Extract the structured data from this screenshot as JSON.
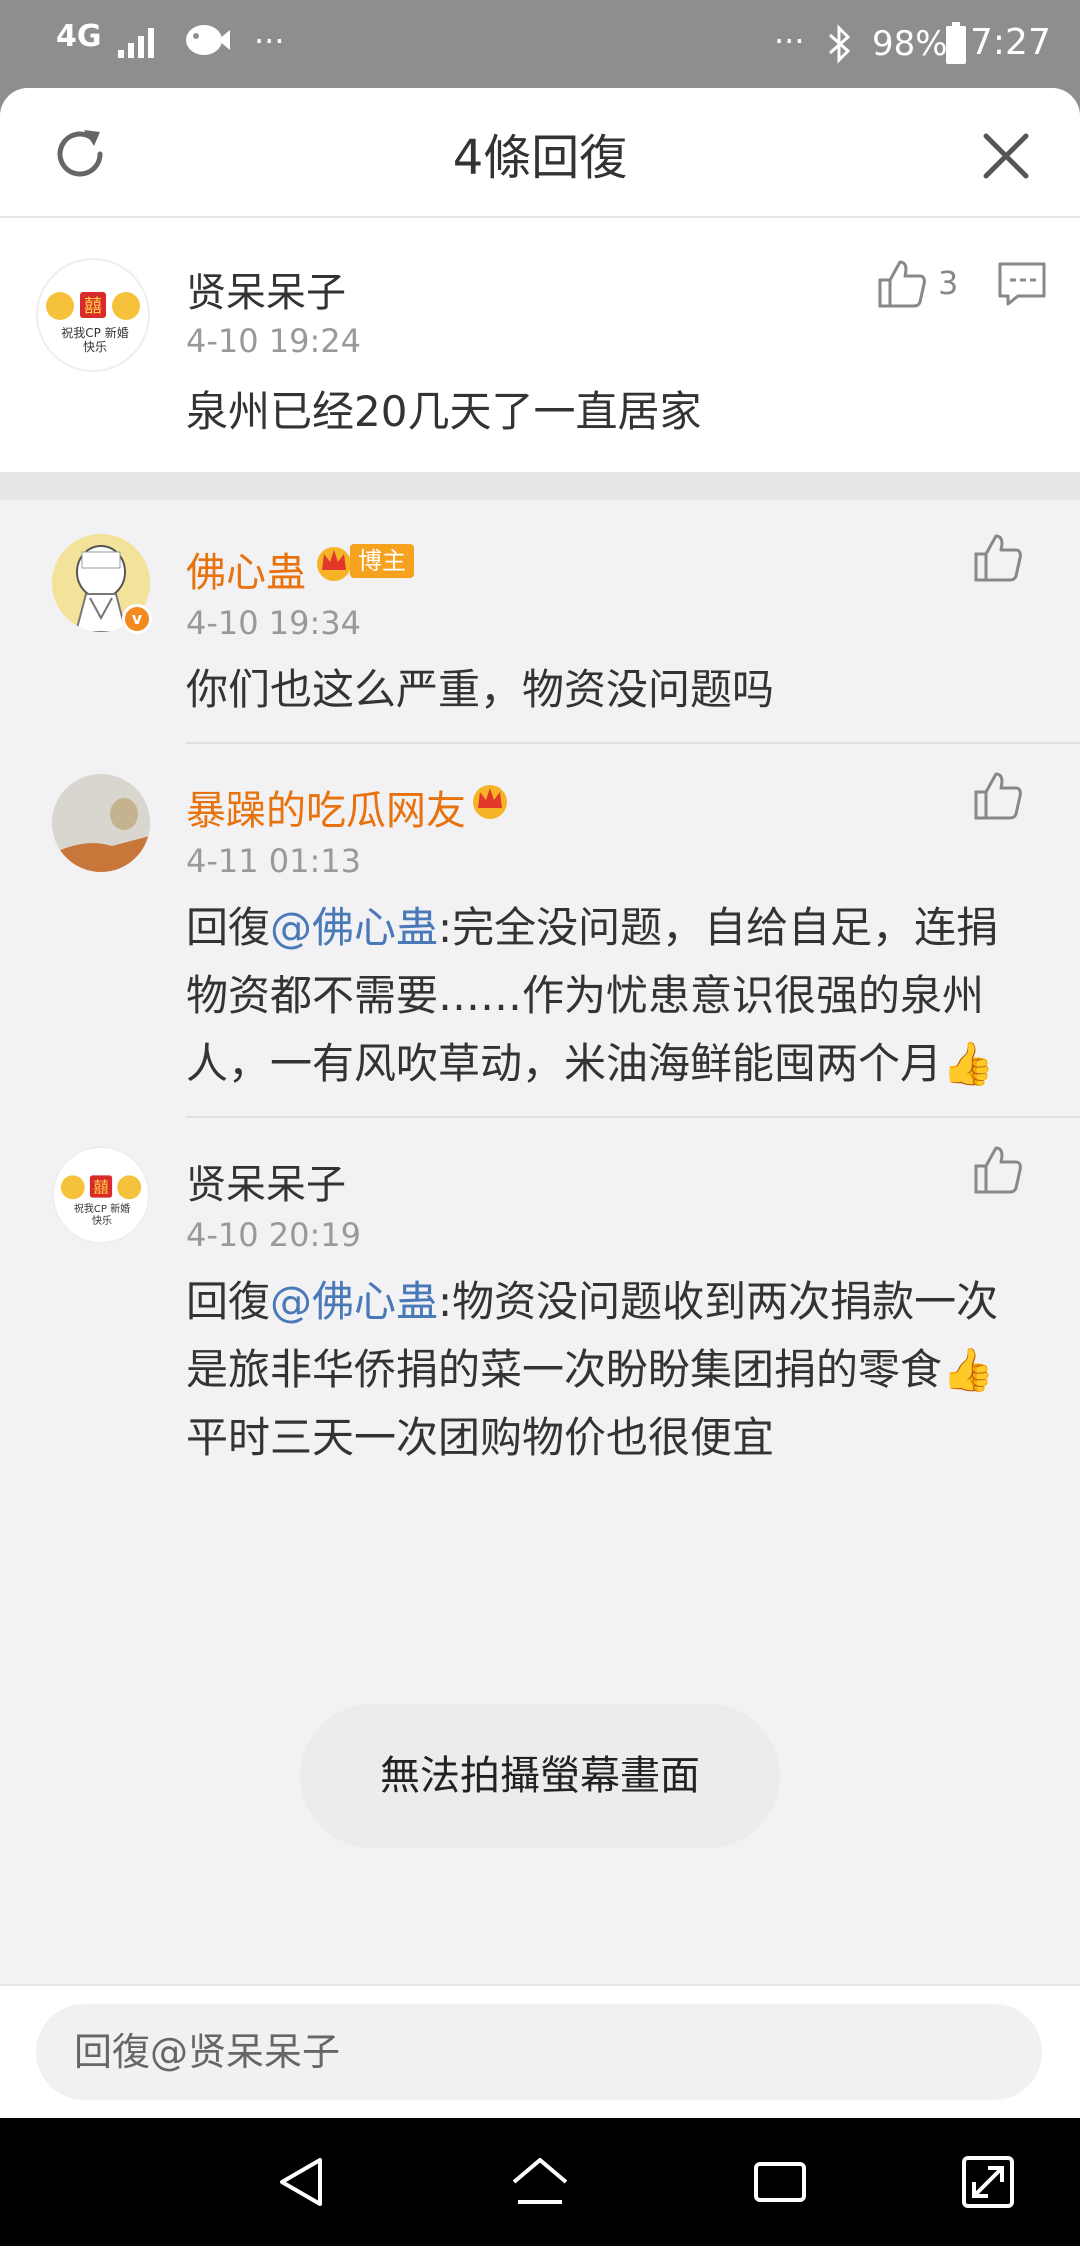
{
  "status_bar": {
    "network": "4G",
    "battery": "98%",
    "time": "7:27",
    "dots": "···"
  },
  "header": {
    "title": "4條回復"
  },
  "original_comment": {
    "user": "贤呆呆子",
    "time": "4-10 19:24",
    "text": "泉州已经20几天了一直居家",
    "likes": "3",
    "avatar_caption": "祝我CP 新婚快乐"
  },
  "replies": [
    {
      "user": "佛心蛊",
      "badge": "博主",
      "time": "4-10 19:34",
      "text": "你们也这么严重，物资没问题吗"
    },
    {
      "user": "暴躁的吃瓜网友",
      "time": "4-11 01:13",
      "prefix": "回復",
      "mention": "@佛心蛊",
      "text_line1": ":完全没问题，自给自足，连捐",
      "text_line2": "物资都不需要……作为忧患意识很强的泉州",
      "text_line3": "人，一有风吹草动，米油海鲜能囤两个月👍"
    },
    {
      "user": "贤呆呆子",
      "time": "4-10 20:19",
      "prefix": "回復",
      "mention": "@佛心蛊",
      "text_line1": ":物资没问题收到两次捐款一次",
      "text_line2": "是旅非华侨捐的菜一次盼盼集团捐的零食👍",
      "text_line3": "平时三天一次团购物价也很便宜",
      "avatar_caption": "祝我CP 新婚快乐"
    }
  ],
  "toast": "無法拍攝螢幕畫面",
  "input": {
    "placeholder": "回復@贤呆呆子"
  },
  "colors": {
    "accent_orange": "#e8730e",
    "mention_blue": "#4a79b7",
    "sheet_bg": "#f2f2f5"
  }
}
